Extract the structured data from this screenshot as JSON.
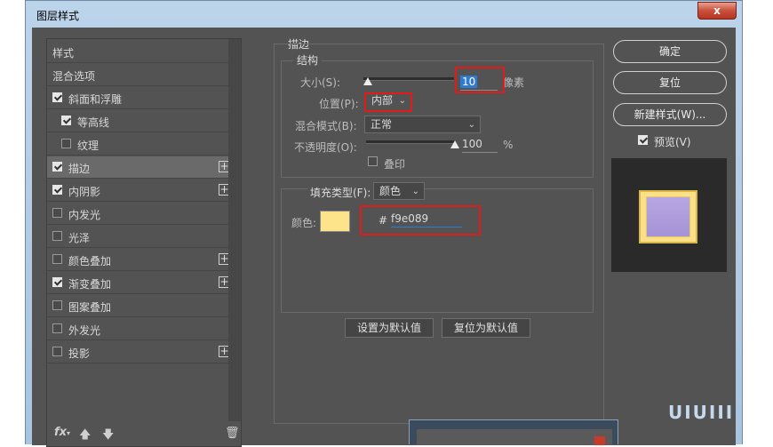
{
  "window": {
    "title": "图层样式",
    "close_label": "x"
  },
  "sidebar": {
    "items": [
      {
        "label": "样式",
        "checkbox": null,
        "plus": false,
        "active": false
      },
      {
        "label": "混合选项",
        "checkbox": null,
        "plus": false,
        "active": false
      },
      {
        "label": "斜面和浮雕",
        "checkbox": true,
        "plus": false,
        "active": false
      },
      {
        "label": "等高线",
        "checkbox": true,
        "plus": false,
        "active": false,
        "indent": true
      },
      {
        "label": "纹理",
        "checkbox": false,
        "plus": false,
        "active": false,
        "indent": true
      },
      {
        "label": "描边",
        "checkbox": true,
        "plus": true,
        "active": true
      },
      {
        "label": "内阴影",
        "checkbox": true,
        "plus": true,
        "active": false
      },
      {
        "label": "内发光",
        "checkbox": false,
        "plus": false,
        "active": false
      },
      {
        "label": "光泽",
        "checkbox": false,
        "plus": false,
        "active": false
      },
      {
        "label": "颜色叠加",
        "checkbox": false,
        "plus": true,
        "active": false
      },
      {
        "label": "渐变叠加",
        "checkbox": true,
        "plus": true,
        "active": false
      },
      {
        "label": "图案叠加",
        "checkbox": false,
        "plus": false,
        "active": false
      },
      {
        "label": "外发光",
        "checkbox": false,
        "plus": false,
        "active": false
      },
      {
        "label": "投影",
        "checkbox": false,
        "plus": true,
        "active": false
      }
    ],
    "plus_label": "+",
    "fx_label": "fx",
    "fx_caret": "▾",
    "up_icon": "up-arrow-icon",
    "down_icon": "down-arrow-icon",
    "trash_icon": "trash-icon"
  },
  "stroke": {
    "title": "描边",
    "structure_title": "结构",
    "size_label": "大小(S):",
    "size_value": "10",
    "size_unit": "像素",
    "position_label": "位置(P):",
    "position_value": "内部",
    "blend_label": "混合模式(B):",
    "blend_value": "正常",
    "opacity_label": "不透明度(O):",
    "opacity_value": "100",
    "opacity_unit": "%",
    "opacity_level": 1.0,
    "size_level": 0.05,
    "emboss_label": "叠印",
    "emboss_checked": false,
    "fill_type_label": "填充类型(F):",
    "fill_type_value": "颜色",
    "color_label": "颜色:",
    "color_swatch": "#fde389",
    "hex_prefix": "#",
    "hex_value": "f9e089",
    "set_default_label": "设置为默认值",
    "reset_default_label": "复位为默认值"
  },
  "actions": {
    "ok_label": "确定",
    "reset_label": "复位",
    "new_style_label": "新建样式(W)...",
    "preview_label": "预览(V)",
    "preview_checked": true
  },
  "colors": {
    "panel_bg": "#535353",
    "highlight_red": "#e31a1a",
    "stroke_color": "#f9e089",
    "fill_purple": "#a898db"
  },
  "watermark": "UIUIII"
}
